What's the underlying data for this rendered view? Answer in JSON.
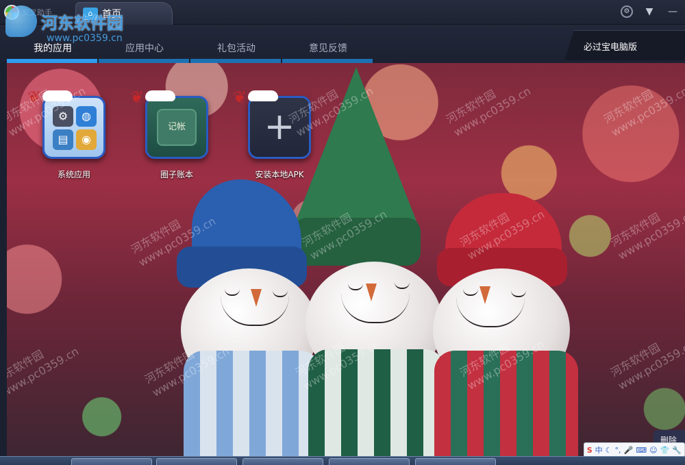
{
  "titlebar": {
    "logo_text": "叉叉助手",
    "home_tab_label": "首页",
    "controls": [
      "settings-icon",
      "menu-down-icon",
      "minimize-icon"
    ]
  },
  "nav": {
    "tabs": [
      {
        "label": "我的应用",
        "active": true
      },
      {
        "label": "应用中心",
        "active": false
      },
      {
        "label": "礼包活动",
        "active": false
      },
      {
        "label": "意见反馈",
        "active": false
      }
    ],
    "right_link": "必过宝电脑版"
  },
  "apps": [
    {
      "label": "系统应用",
      "icon": "system-apps-icon"
    },
    {
      "label": "圈子账本",
      "icon": "circle-ledger-icon"
    },
    {
      "label": "安装本地APK",
      "icon": "plus-icon"
    }
  ],
  "circle_app_inner_text": "记帐",
  "delete_button": "删除",
  "tray": {
    "ime": "S",
    "ime_mode": "中"
  },
  "watermark": {
    "title": "河东软件园",
    "url": "www.pc0359.cn"
  },
  "colors": {
    "accent": "#2e9cf0",
    "nav_bar": "#1c71b3",
    "titlebar_bg": "#222839"
  }
}
